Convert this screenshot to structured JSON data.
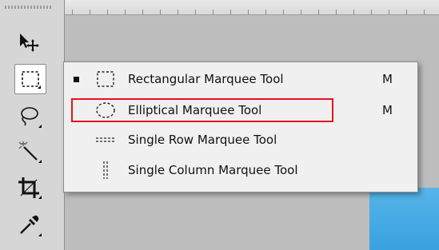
{
  "toolbar": {
    "tools": [
      {
        "name": "move-tool",
        "icon": "move-icon"
      },
      {
        "name": "marquee-tool",
        "icon": "rectangular-marquee-icon",
        "active": true
      },
      {
        "name": "lasso-tool",
        "icon": "lasso-icon"
      },
      {
        "name": "magic-wand-tool",
        "icon": "magic-wand-icon"
      },
      {
        "name": "crop-tool",
        "icon": "crop-icon"
      },
      {
        "name": "eyedropper-tool",
        "icon": "eyedropper-icon"
      }
    ]
  },
  "flyout": {
    "items": [
      {
        "label": "Rectangular Marquee Tool",
        "shortcut": "M",
        "selected": true,
        "icon": "rectangular-marquee-icon"
      },
      {
        "label": "Elliptical Marquee Tool",
        "shortcut": "M",
        "selected": false,
        "icon": "elliptical-marquee-icon",
        "highlighted": true
      },
      {
        "label": "Single Row Marquee Tool",
        "shortcut": "",
        "selected": false,
        "icon": "single-row-marquee-icon"
      },
      {
        "label": "Single Column Marquee Tool",
        "shortcut": "",
        "selected": false,
        "icon": "single-column-marquee-icon"
      }
    ],
    "highlight_color": "#e8121c"
  },
  "colors": {
    "canvas_accent": "#4aaee5"
  }
}
